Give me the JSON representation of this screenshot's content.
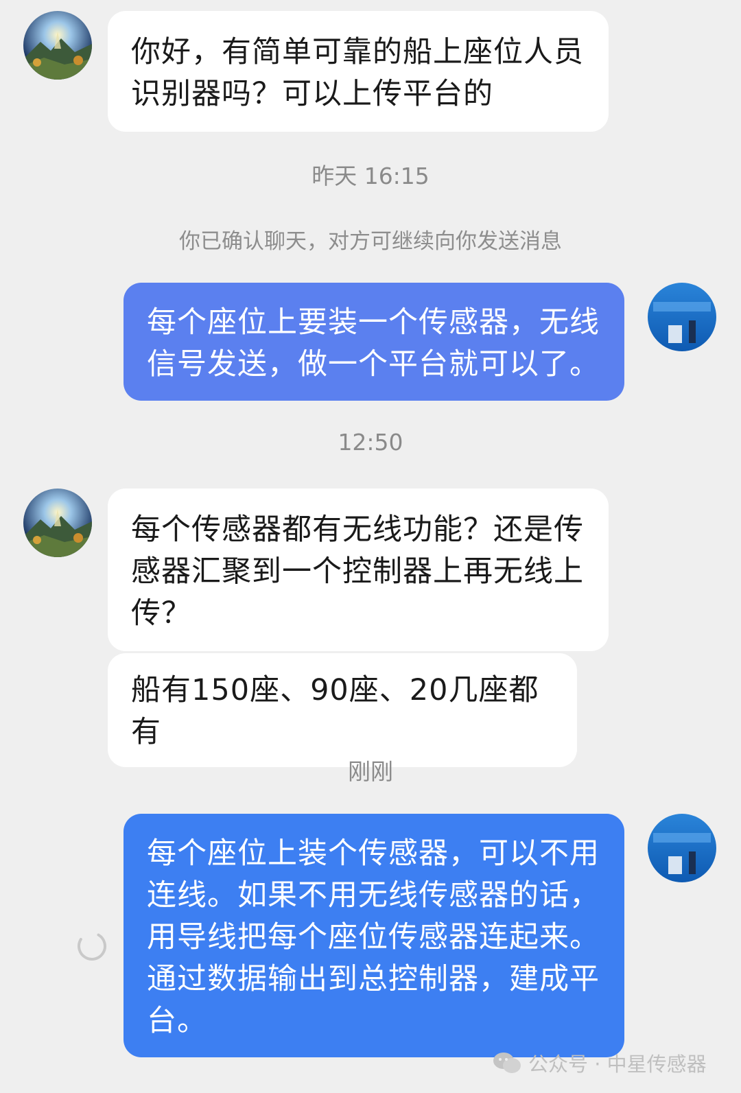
{
  "messages": [
    {
      "role": "incoming",
      "text": "你好，有简单可靠的船上座位人员识别器吗？可以上传平台的"
    },
    {
      "role": "outgoing",
      "text": "每个座位上要装一个传感器，无线信号发送，做一个平台就可以了。"
    },
    {
      "role": "incoming",
      "text": "每个传感器都有无线功能？还是传感器汇聚到一个控制器上再无线上传？"
    },
    {
      "role": "incoming",
      "text": "船有150座、90座、20几座都有"
    },
    {
      "role": "outgoing",
      "text": "每个座位上装个传感器，可以不用连线。如果不用无线传感器的话，用导线把每个座位传感器连起来。通过数据输出到总控制器，建成平台。"
    }
  ],
  "timestamps": {
    "t1": "昨天 16:15",
    "t2": "12:50",
    "t3": "刚刚"
  },
  "system_notice": "你已确认聊天，对方可继续向你发送消息",
  "watermark": "公众号 · 中星传感器",
  "colors": {
    "background": "#efefef",
    "incoming_bubble": "#ffffff",
    "outgoing_bubble": "#5b80ef",
    "outgoing_bubble_latest": "#3d7ff2"
  },
  "icons": {
    "loading": "spinner-icon",
    "watermark_logo": "wechat-icon"
  }
}
